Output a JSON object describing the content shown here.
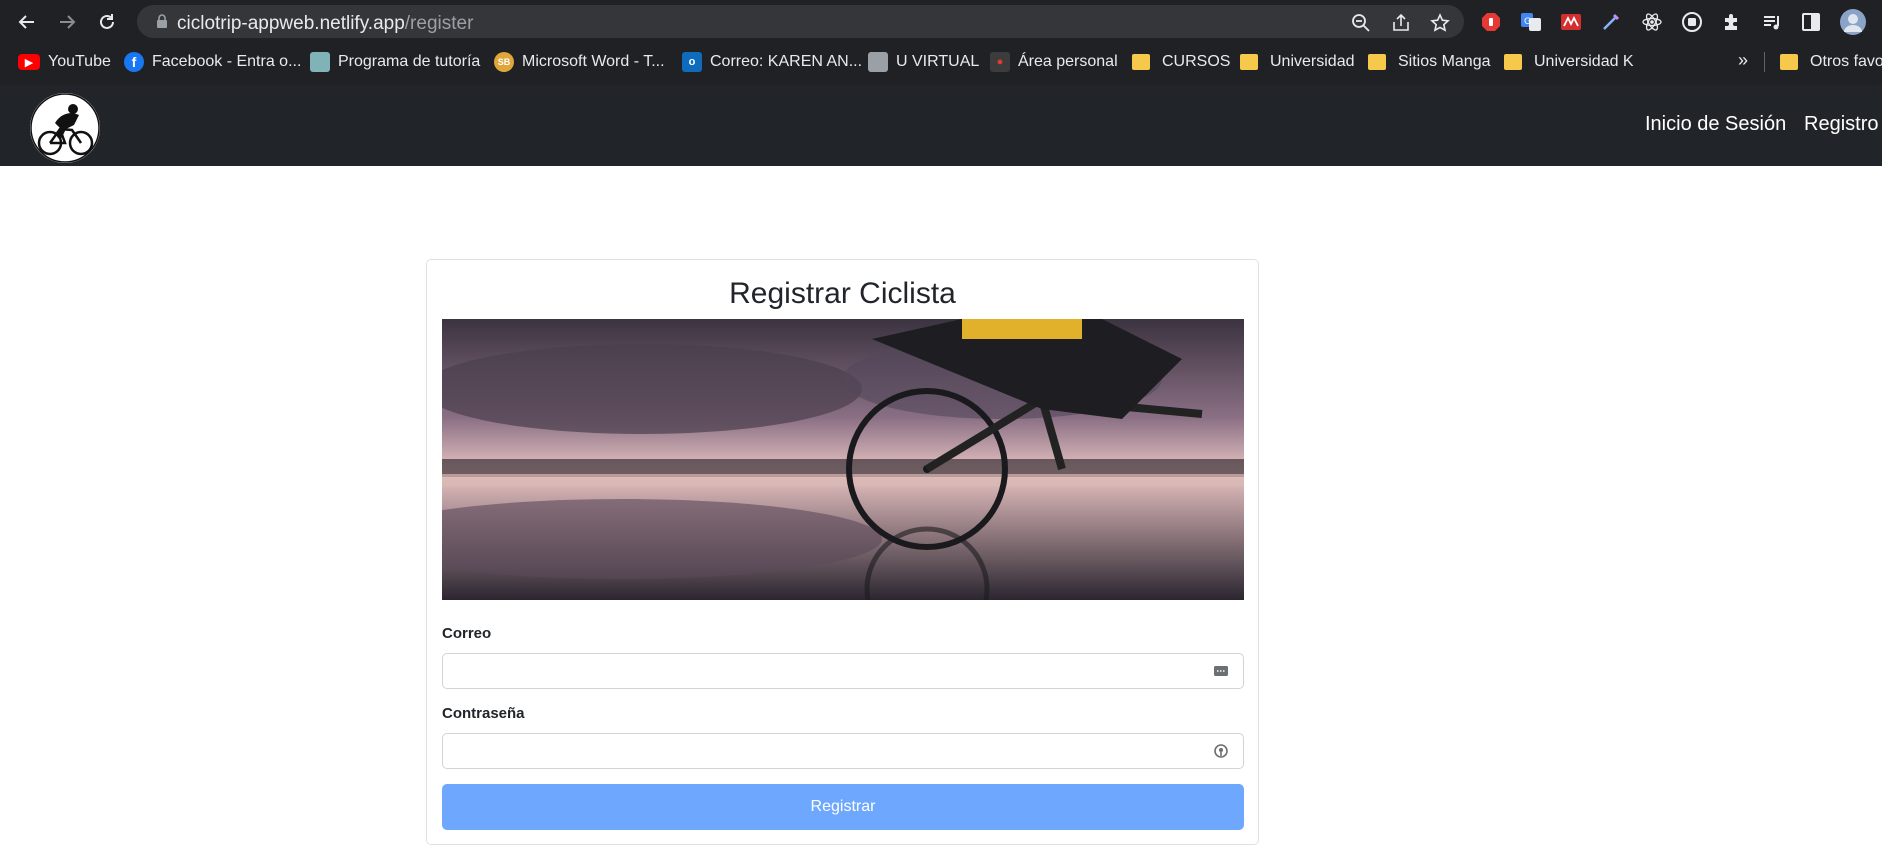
{
  "browser": {
    "url_host": "ciclotrip-appweb.netlify.app",
    "url_path": "/register",
    "bookmarks": [
      {
        "label": "YouTube",
        "icon": "youtube-icon",
        "color": "#ff0000"
      },
      {
        "label": "Facebook - Entra o...",
        "icon": "facebook-icon",
        "color": "#1877f2"
      },
      {
        "label": "Programa de tutoría",
        "icon": "tutoring-icon",
        "color": "#7fb3b8"
      },
      {
        "label": "Microsoft Word - T...",
        "icon": "word-doc-icon",
        "color": "#e0a63a"
      },
      {
        "label": "Correo: KAREN AN...",
        "icon": "outlook-icon",
        "color": "#0f6cbd"
      },
      {
        "label": "U VIRTUAL",
        "icon": "uvirtual-icon",
        "color": "#9aa0a6"
      },
      {
        "label": "Área personal",
        "icon": "personal-area-icon",
        "color": "#c0392b"
      },
      {
        "label": "CURSOS",
        "icon": "folder-icon"
      },
      {
        "label": "Universidad",
        "icon": "folder-icon"
      },
      {
        "label": "Sitios Manga",
        "icon": "folder-icon"
      },
      {
        "label": "Universidad K",
        "icon": "folder-icon"
      }
    ],
    "more_bookmarks": "»",
    "other_bookmarks": "Otros favor"
  },
  "navbar": {
    "links": [
      "Inicio de Sesión",
      "Registro"
    ]
  },
  "form": {
    "title": "Registrar Ciclista",
    "email_label": "Correo",
    "password_label": "Contraseña",
    "submit_label": "Registrar"
  },
  "colors": {
    "navbar_bg": "#212529",
    "submit_bg": "#6ea8fe",
    "chrome_bg": "#202124"
  }
}
